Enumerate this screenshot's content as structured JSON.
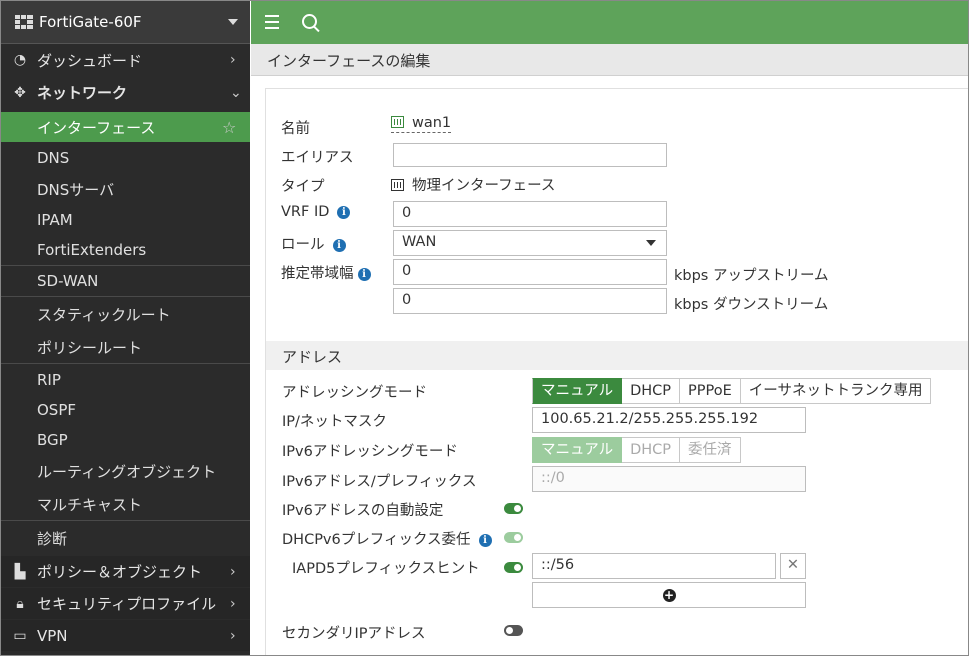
{
  "sidebar": {
    "device": "FortiGate-60F",
    "items": [
      {
        "label": "ダッシュボード",
        "icon": "dashboard-icon"
      },
      {
        "label": "ネットワーク",
        "icon": "network-icon"
      },
      {
        "label": "インターフェース"
      },
      {
        "label": "DNS"
      },
      {
        "label": "DNSサーバ"
      },
      {
        "label": "IPAM"
      },
      {
        "label": "FortiExtenders"
      },
      {
        "label": "SD-WAN"
      },
      {
        "label": "スタティックルート"
      },
      {
        "label": "ポリシールート"
      },
      {
        "label": "RIP"
      },
      {
        "label": "OSPF"
      },
      {
        "label": "BGP"
      },
      {
        "label": "ルーティングオブジェクト"
      },
      {
        "label": "マルチキャスト"
      },
      {
        "label": "診断"
      },
      {
        "label": "ポリシー＆オブジェクト",
        "icon": "policy-icon"
      },
      {
        "label": "セキュリティプロファイル",
        "icon": "lock-icon"
      },
      {
        "label": "VPN",
        "icon": "monitor-icon"
      }
    ]
  },
  "header": {
    "page_title": "インターフェースの編集"
  },
  "form": {
    "name_label": "名前",
    "name_value": "wan1",
    "alias_label": "エイリアス",
    "alias_value": "",
    "type_label": "タイプ",
    "type_value": "物理インターフェース",
    "vrf_label": "VRF ID",
    "vrf_value": "0",
    "role_label": "ロール",
    "role_value": "WAN",
    "bw_label": "推定帯域幅",
    "bw_up_value": "0",
    "bw_up_unit": "kbps アップストリーム",
    "bw_down_value": "0",
    "bw_down_unit": "kbps ダウンストリーム"
  },
  "address": {
    "section_title": "アドレス",
    "mode_label": "アドレッシングモード",
    "modes": [
      "マニュアル",
      "DHCP",
      "PPPoE",
      "イーサネットトランク専用"
    ],
    "ip_label": "IP/ネットマスク",
    "ip_value": "100.65.21.2/255.255.255.192",
    "ipv6_mode_label": "IPv6アドレッシングモード",
    "ipv6_modes": [
      "マニュアル",
      "DHCP",
      "委任済"
    ],
    "ipv6_prefix_label": "IPv6アドレス/プレフィックス",
    "ipv6_prefix_value": "::/0",
    "ipv6_auto_label": "IPv6アドレスの自動設定",
    "ipv6_auto": true,
    "dhcpv6_label": "DHCPv6プレフィックス委任",
    "dhcpv6": true,
    "iapd_label": "IAPD5プレフィックスヒント",
    "iapd_value": "::/56",
    "iapd": true,
    "secondary_label": "セカンダリIPアドレス",
    "secondary": false
  }
}
